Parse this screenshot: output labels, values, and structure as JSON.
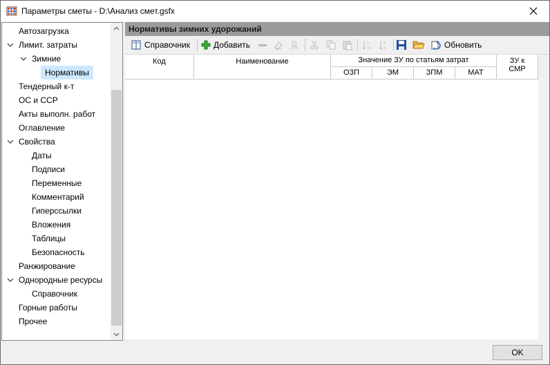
{
  "window": {
    "title": "Параметры сметы - D:\\Анализ смет.gsfx"
  },
  "sidebar": {
    "items": [
      {
        "label": "Автозагрузка"
      },
      {
        "label": "Лимит. затраты"
      },
      {
        "label": "Зимние"
      },
      {
        "label": "Нормативы"
      },
      {
        "label": "Тендерный к-т"
      },
      {
        "label": "ОС и ССР"
      },
      {
        "label": "Акты выполн. работ"
      },
      {
        "label": "Оглавление"
      },
      {
        "label": "Свойства"
      },
      {
        "label": "Даты"
      },
      {
        "label": "Подписи"
      },
      {
        "label": "Переменные"
      },
      {
        "label": "Комментарий"
      },
      {
        "label": "Гиперссылки"
      },
      {
        "label": "Вложения"
      },
      {
        "label": "Таблицы"
      },
      {
        "label": "Безопасность"
      },
      {
        "label": "Ранжирование"
      },
      {
        "label": "Однородные ресурсы"
      },
      {
        "label": "Справочник"
      },
      {
        "label": "Горные работы"
      },
      {
        "label": "Прочее"
      }
    ]
  },
  "panel": {
    "header": "Нормативы зимних удорожаний",
    "toolbar": {
      "reference_label": "Справочник",
      "add_label": "Добавить",
      "refresh_label": "Обновить"
    },
    "columns": {
      "code": "Код",
      "name": "Наименование",
      "value_group": "Значение ЗУ по статьям затрат",
      "ozp": "ОЗП",
      "em": "ЭМ",
      "zpm": "ЗПМ",
      "mat": "МАТ",
      "zu_smr_1": "ЗУ к",
      "zu_smr_2": "СМР"
    }
  },
  "footer": {
    "ok_label": "OK"
  },
  "colors": {
    "selection": "#cce8ff",
    "panel_header": "#9b9b9b",
    "accent_green": "#2e9b2e"
  }
}
